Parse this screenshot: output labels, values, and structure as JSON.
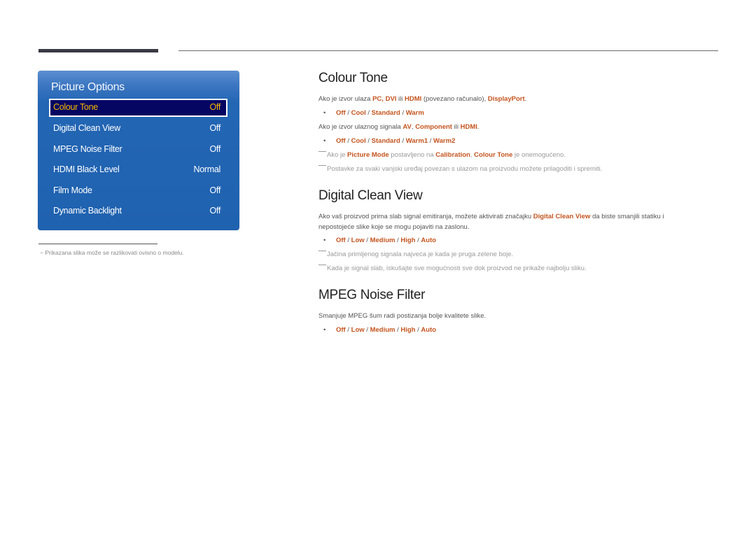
{
  "osd": {
    "title": "Picture Options",
    "items": [
      {
        "label": "Colour Tone",
        "value": "Off",
        "selected": true
      },
      {
        "label": "Digital Clean View",
        "value": "Off"
      },
      {
        "label": "MPEG Noise Filter",
        "value": "Off"
      },
      {
        "label": "HDMI Black Level",
        "value": "Normal"
      },
      {
        "label": "Film Mode",
        "value": "Off"
      },
      {
        "label": "Dynamic Backlight",
        "value": "Off"
      }
    ]
  },
  "footnote": "Prikazana slika može se razlikovati ovisno o modelu.",
  "footnote_dash": "−",
  "sections": {
    "colour_tone": {
      "title": "Colour Tone",
      "line1": {
        "pre": "Ako je izvor ulaza ",
        "pc": "PC",
        "comma1": ", ",
        "dvi": "DVI",
        "ili": " ili ",
        "hdmi": "HDMI",
        "mid": " (povezano računalo), ",
        "dp": "DisplayPort",
        "end": "."
      },
      "opts1": [
        "Off",
        "Cool",
        "Standard",
        "Warm"
      ],
      "line2": {
        "pre": "Ako je izvor ulaznog signala ",
        "av": "AV",
        "comma": ", ",
        "comp": "Component",
        "ili": " ili ",
        "hdmi": "HDMI",
        "end": "."
      },
      "opts2": [
        "Off",
        "Cool",
        "Standard",
        "Warm1",
        "Warm2"
      ],
      "note1": {
        "pre": "Ako je ",
        "pm": "Picture Mode",
        "mid": " postavljeno na ",
        "cal": "Calibration",
        "comma": ", ",
        "ct": "Colour Tone",
        "end": " je onemogućeno."
      },
      "note2": "Postavke za svaki vanjski uređaj povezan s ulazom na proizvodu možete prilagoditi i spremiti."
    },
    "digital_clean_view": {
      "title": "Digital Clean View",
      "para": {
        "pre": "Ako vaš proizvod prima slab signal emitiranja, možete aktivirati značajku ",
        "hl": "Digital Clean View",
        "post": " da biste smanjili statiku i nepostojeće slike koje se mogu pojaviti na zaslonu."
      },
      "opts": [
        "Off",
        "Low",
        "Medium",
        "High",
        "Auto"
      ],
      "note1": "Jačina primljenog signala najveća je kada je pruga zelene boje.",
      "note2": "Kada je signal slab, iskušajte sve mogućnosti sve dok proizvod ne prikaže najbolju sliku."
    },
    "mpeg_noise_filter": {
      "title": "MPEG Noise Filter",
      "para": "Smanjuje MPEG šum radi postizanja bolje kvalitete slike.",
      "opts": [
        "Off",
        "Low",
        "Medium",
        "High",
        "Auto"
      ]
    }
  },
  "separator": " / ",
  "bullet": "•",
  "colors": {
    "accent": "#c4541e",
    "osd_blue": "#1f62b0",
    "osd_selected_bg": "#050562",
    "osd_selected_text": "#f5b800"
  }
}
